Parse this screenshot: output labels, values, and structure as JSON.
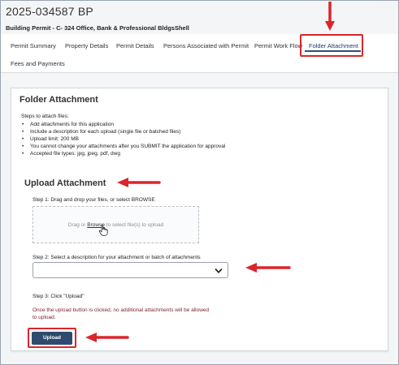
{
  "header": {
    "title": "2025-034587 BP",
    "subtitle": "Building Permit - C- 324 Office, Bank & Professional BldgsShell"
  },
  "tabs": [
    {
      "label": "Permit Summary"
    },
    {
      "label": "Property Details"
    },
    {
      "label": "Permit Details"
    },
    {
      "label": "Persons Associated with Permit"
    },
    {
      "label": "Permit Work Flow"
    },
    {
      "label": "Folder Attachment",
      "active": true
    },
    {
      "label": "Fees and Payments"
    }
  ],
  "folder_attachment": {
    "title": "Folder Attachment",
    "steps_intro": "Steps to attach files:",
    "steps": [
      "Add attachments for this application",
      "Include a description for each upload (single file or batched files)",
      "Upload limit: 200 MB",
      "You cannot change your attachments after you SUBMIT the application for approval",
      "Accepted file types: jpg, jpeg, pdf, dwg"
    ]
  },
  "upload": {
    "title": "Upload Attachment",
    "step1": "Step 1: Drag and drop your files, or select BROWSE",
    "drop_prefix": "Drag or ",
    "browse_link": "Browse",
    "drop_suffix": " to select file(s) to upload",
    "step2": "Step 2: Select a description for your attachment or batch of attachments",
    "select_value": "",
    "step3": "Step 3: Click \"Upload\"",
    "warning": "Once the upload button is clicked, no additional attachments will be allowed to upload.",
    "button_label": "Upload"
  },
  "colors": {
    "highlight": "#d9262b",
    "accent": "#2e4a6e",
    "warning_text": "#7a1f2e"
  },
  "icons": [
    "hand-pointer-icon",
    "chevron-down-icon",
    "red-arrow-annotation"
  ]
}
